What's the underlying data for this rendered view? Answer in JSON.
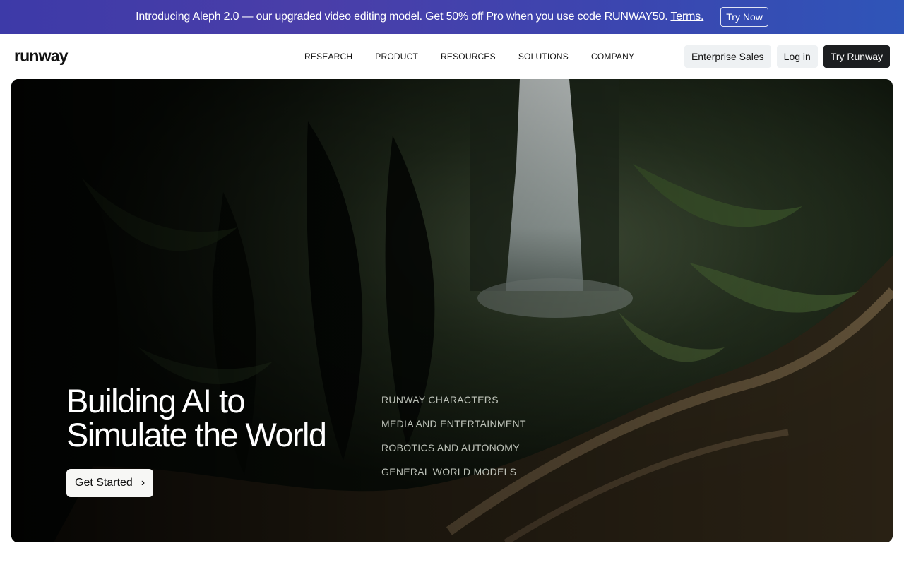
{
  "banner": {
    "text": "Introducing Aleph 2.0 — our upgraded video editing model. Get 50% off Pro when you use code RUNWAY50.",
    "terms": "Terms.",
    "cta": "Try Now"
  },
  "nav": {
    "logo": "runway",
    "links": [
      "RESEARCH",
      "PRODUCT",
      "RESOURCES",
      "SOLUTIONS",
      "COMPANY"
    ],
    "enterprise": "Enterprise Sales",
    "login": "Log in",
    "try": "Try Runway"
  },
  "hero": {
    "title_line1": "Building AI to",
    "title_line2": "Simulate the World",
    "cta": "Get Started",
    "topics": [
      "RUNWAY CHARACTERS",
      "MEDIA AND ENTERTAINMENT",
      "ROBOTICS AND AUTONOMY",
      "GENERAL WORLD MODELS"
    ]
  },
  "icons": {
    "cta_arrow": "chevron-right-icon"
  },
  "colors": {
    "banner_start": "#3d3aa8",
    "banner_end": "#2f55b8",
    "dark_button": "#1c1e20"
  }
}
